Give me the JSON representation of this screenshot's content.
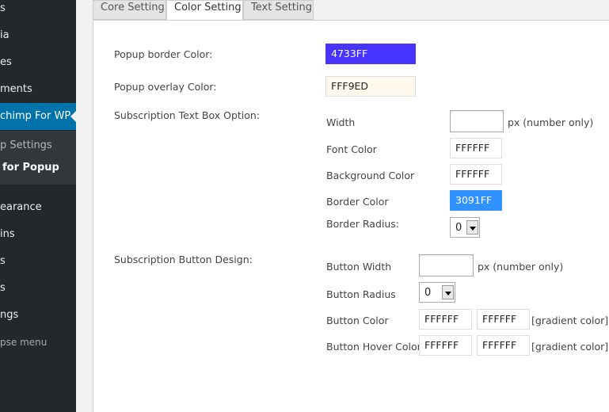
{
  "sidebar": {
    "items": [
      {
        "label": "s"
      },
      {
        "label": "ia"
      },
      {
        "label": "es"
      },
      {
        "label": "ments"
      },
      {
        "label": "chimp For WP"
      },
      {
        "label": "earance"
      },
      {
        "label": "ins"
      },
      {
        "label": "s"
      },
      {
        "label": "s"
      },
      {
        "label": "ngs"
      },
      {
        "label": "pse menu"
      }
    ],
    "submenu": [
      {
        "label": "p Settings"
      },
      {
        "label": "for Popup"
      }
    ]
  },
  "tabs": [
    {
      "label": "Core Setting"
    },
    {
      "label": "Color Setting"
    },
    {
      "label": "Text Setting"
    }
  ],
  "popup": {
    "border_color_label": "Popup border Color:",
    "border_color_value": "4733FF",
    "border_color_bg": "#4733FF",
    "overlay_color_label": "Popup overlay Color:",
    "overlay_color_value": "FFF9ED",
    "overlay_color_bg": "#FFF9ED"
  },
  "textbox": {
    "section_label": "Subscription Text Box Option:",
    "width_label": "Width",
    "width_value": "",
    "width_hint": "px (number only)",
    "font_color_label": "Font Color",
    "font_color_value": "FFFFFF",
    "bg_color_label": "Background Color",
    "bg_color_value": "FFFFFF",
    "border_color_label": "Border Color",
    "border_color_value": "3091FF",
    "border_color_bg": "#3091FF",
    "border_radius_label": "Border Radius:",
    "border_radius_value": "0"
  },
  "button": {
    "section_label": "Subscription Button Design:",
    "width_label": "Button Width",
    "width_value": "",
    "width_hint": "px (number only)",
    "radius_label": "Button Radius",
    "radius_value": "0",
    "color_label": "Button Color",
    "color_value_1": "FFFFFF",
    "color_value_2": "FFFFFF",
    "color_hint": "[gradient color]",
    "hover_label": "Button Hover Color",
    "hover_value_1": "FFFFFF",
    "hover_value_2": "FFFFFF",
    "hover_hint": "[gradient color]"
  }
}
